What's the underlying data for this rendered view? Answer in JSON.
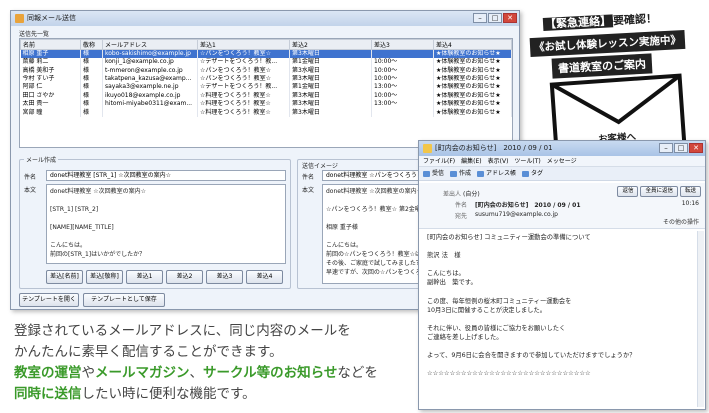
{
  "main_window": {
    "title": "同報メール送信",
    "recipients_label": "送信先一覧",
    "columns": [
      "名前",
      "敬称",
      "メールアドレス",
      "差込1",
      "差込2",
      "差込3",
      "差込4"
    ],
    "rows": [
      [
        "相原 重子",
        "様",
        "kobo-sakishimo@example.jp",
        "☆パンをつくろう！教室☆",
        "第3木曜日",
        "",
        "★体験教室のお知らせ★"
      ],
      [
        "斎藤 莉二",
        "様",
        "konji_1@example.co.jp",
        "☆デザートをつくろう！教...",
        "第1金曜日",
        "10:00〜",
        "★体験教室のお知らせ★"
      ],
      [
        "高橋 美和子",
        "様",
        "t-mmeron@example.co.jp",
        "☆パンをつくろう！教室☆",
        "第3水曜日",
        "10:00〜",
        "★体験教室のお知らせ★"
      ],
      [
        "今村 すい子",
        "様",
        "takatpena_kazusa@examp...",
        "☆パンをつくろう！教室☆",
        "第3木曜日",
        "10:00〜",
        "★体験教室のお知らせ★"
      ],
      [
        "阿部 仁",
        "様",
        "sayaka3@example.ne.jp",
        "☆デザートをつくろう！教...",
        "第1金曜日",
        "13:00〜",
        "★体験教室のお知らせ★"
      ],
      [
        "田口 さやか",
        "様",
        "ikuyo018@example.co.jp",
        "☆料理をつくろう！教室☆",
        "第3木曜日",
        "10:00〜",
        "★体験教室のお知らせ★"
      ],
      [
        "太田 貴一",
        "様",
        "hitomi-miyabe0311@exam...",
        "☆料理をつくろう！教室☆",
        "第3木曜日",
        "13:00〜",
        "★体験教室のお知らせ★"
      ],
      [
        "宮部 瞳",
        "様",
        "",
        "☆料理をつくろう！教室☆",
        "第3木曜日",
        "",
        "★体験教室のお知らせ★"
      ]
    ],
    "compose_label": "メール作成",
    "subject_label": "件名",
    "subject_value": "donet料理教室 [STR_1] ☆次回教室の案内☆",
    "body_label": "本文",
    "body_lines": [
      "donet料理教室 ☆次回教室の案内☆",
      "",
      "[STR_1] [STR_2]",
      "",
      "[NAME][NAME_TITLE]",
      "",
      "こんにちは。",
      "前回の[STR_1]はいかがでしたか？"
    ],
    "insert_buttons": [
      "差込[名前]",
      "差込[敬称]",
      "差込1",
      "差込2",
      "差込3",
      "差込4"
    ],
    "preview_label": "送信イメージ",
    "preview_subject": "donet料理教室 ☆パンをつくろう！教室☆",
    "preview_lines": [
      "donet料理教室 ☆次回教室の案内☆",
      "",
      "☆パンをつくろう！教室☆ 第2金曜日",
      "",
      "相原 重子様",
      "",
      "こんにちは。",
      "前回の☆パンをつくろう！教室☆はいかが",
      "その後、ご家庭で試してみました？",
      "早速ですが、次回の☆パンをつくろう"
    ],
    "template_open_button": "テンプレートを開く",
    "template_save_button": "テンプレートとして保存"
  },
  "mail_window": {
    "title": "[町内会のお知らせ]　2010 / 09 / 01",
    "menu": [
      "ファイル(F)",
      "編集(E)",
      "表示(V)",
      "ツール(T)",
      "メッセージ"
    ],
    "toolbar": [
      "受信",
      "作成",
      "アドレス帳",
      "タグ"
    ],
    "reply_buttons": [
      "返信",
      "全員に返信",
      "転送"
    ],
    "from_label": "差出人",
    "from_value": "(自分)",
    "subject_label": "件名",
    "subject_value": "[町内会のお知らせ]　2010 / 09 / 01",
    "to_label": "宛先",
    "to_value": "susumu719@example.co.jp",
    "time": "10:16",
    "other_actions": "その他の操作",
    "body_lines": [
      "[町内会のお知らせ] コミュニティー運動会の準備について",
      "",
      "熊沢 法　様",
      "",
      "こんにちは。",
      "副幹出　築です。",
      "",
      "この度、毎年恒例の桜木町コミュニティー運動会を",
      "10月3日に開催することが決定しました。",
      "",
      "それに伴い、役員の皆様にご協力をお願いしたく",
      "ご連絡を差し上げました。",
      "",
      "よって、9月6日に会合を開きますので参加していただけますでしょうか？",
      "",
      "☆☆☆☆☆☆☆☆☆☆☆☆☆☆☆☆☆☆☆☆☆☆☆☆☆☆☆☆☆"
    ]
  },
  "banner": {
    "line1_bracket": "【緊急連絡】",
    "line1_rest": "要確認！",
    "line2": "《お試し体験レッスン実施中》",
    "line3": "書道教室のご案内",
    "envelope_text": "お客様へ"
  },
  "caption": {
    "line1": "登録されているメールアドレスに、同じ内容のメールを",
    "line2": "かんたんに素早く配信することができます。",
    "l3_a": "教室の運営",
    "l3_b": "や",
    "l3_c": "メールマガジン",
    "l3_d": "、",
    "l3_e": "サークル等のお知らせ",
    "l3_f": "などを",
    "l4_a": "同時に送信",
    "l4_b": "したい時に便利な機能です。"
  },
  "colors": {
    "accent_green": "#3a9a2a",
    "selection_blue": "#3f73cf"
  }
}
